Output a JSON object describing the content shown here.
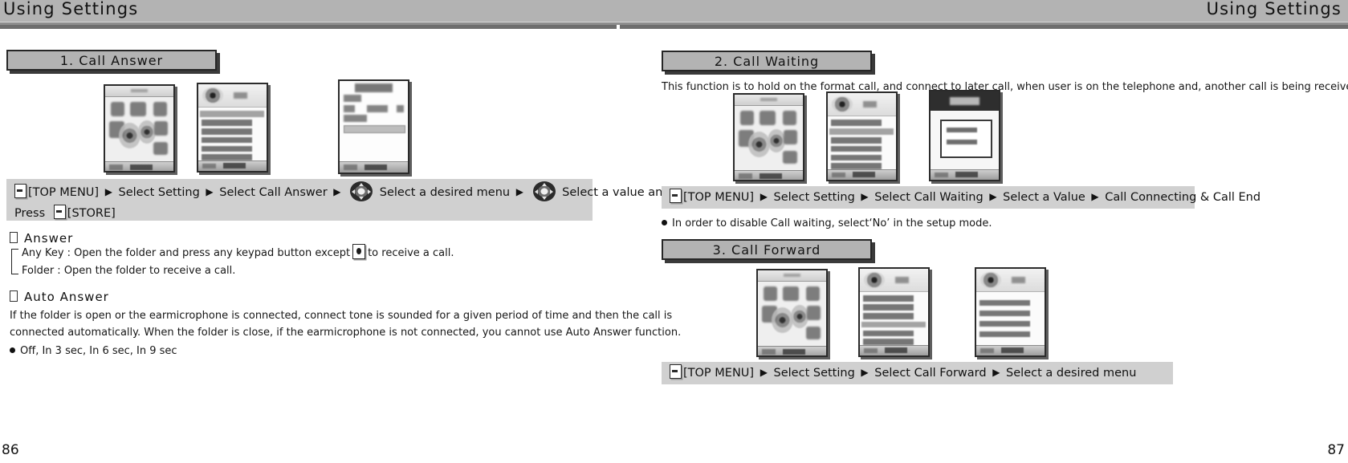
{
  "header": {
    "left_title": "Using Settings",
    "right_title": "Using Settings"
  },
  "left_page": {
    "page_number": "86",
    "section": {
      "title": "1. Call Answer"
    },
    "screens": [
      {
        "name": "settings-icon-menu-screen"
      },
      {
        "name": "settings-list-screen"
      },
      {
        "name": "call-answer-detail-screen"
      }
    ],
    "instruction": {
      "key1": "[TOP MENU]",
      "step1": "Select Setting",
      "step2": "Select Call Answer",
      "step3": "Select a desired menu",
      "step4": "Select a value and",
      "tail_pre": "Press",
      "key2": "[STORE]",
      "arrow": "▶"
    },
    "answer": {
      "heading": "Answer",
      "option1_pre": "Any Key : Open the folder and press any keypad button except",
      "option1_post": "to receive a call.",
      "option2": "Folder : Open the folder to receive a call."
    },
    "auto_answer": {
      "heading": "Auto Answer",
      "line1": "If the folder is open or the earmicrophone is connected, connect tone is sounded for a given period of time and then the call is",
      "line2": "connected automatically. When the folder is close, if the earmicrophone is not connected, you cannot use Auto Answer function.",
      "values": "Off, In 3 sec, In 6 sec, In 9 sec"
    }
  },
  "right_page": {
    "page_number": "87",
    "call_waiting": {
      "title": "2. Call Waiting",
      "description": "This function is to hold on the format call, and connect to later call, when user is on the telephone and, another call is being received.",
      "screens": [
        {
          "name": "settings-icon-menu-screen"
        },
        {
          "name": "settings-list-screen"
        },
        {
          "name": "call-waiting-dialog-screen"
        }
      ],
      "instruction": {
        "key1": "[TOP MENU]",
        "step1": "Select Setting",
        "step2": "Select Call Waiting",
        "step3": "Select a Value",
        "step4": "Call Connecting & Call End",
        "arrow": "▶"
      },
      "note": "In order to disable Call waiting, select‘No’ in the setup mode."
    },
    "call_forward": {
      "title": "3. Call Forward",
      "screens": [
        {
          "name": "settings-icon-menu-screen"
        },
        {
          "name": "settings-list-screen"
        },
        {
          "name": "call-forward-list-screen"
        }
      ],
      "instruction": {
        "key1": "[TOP MENU]",
        "step1": "Select Setting",
        "step2": "Select Call Forward",
        "step3": "Select a desired menu",
        "arrow": "▶"
      }
    }
  }
}
